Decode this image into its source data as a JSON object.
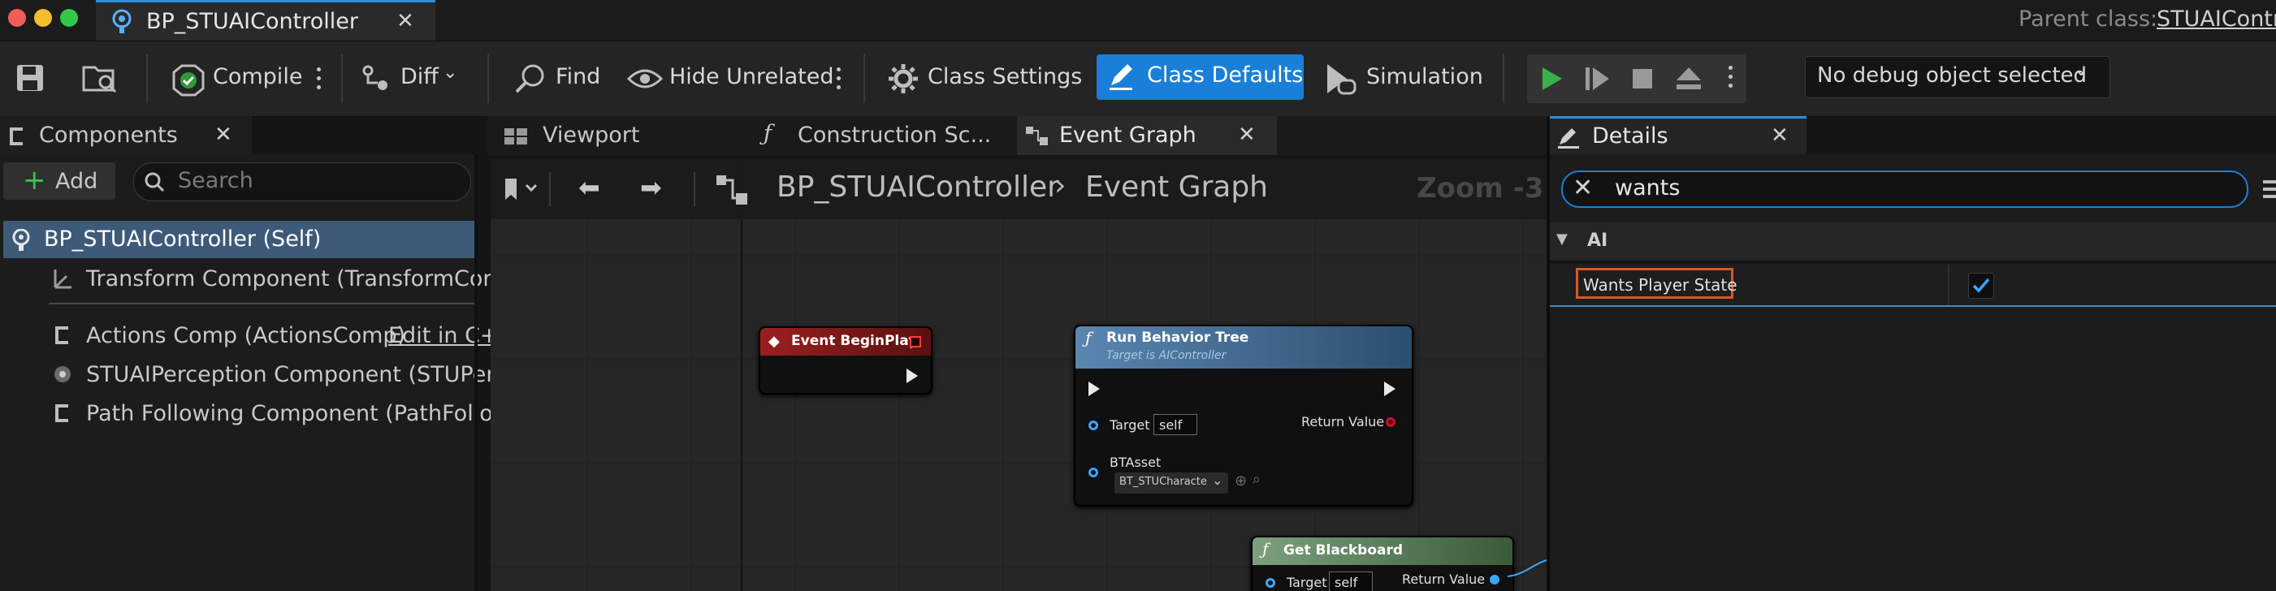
{
  "window": {
    "tab_title": "BP_STUAIController",
    "parent_class_label": "Parent class:",
    "parent_class_value": "STUAIController"
  },
  "toolbar": {
    "compile": "Compile",
    "diff": "Diff",
    "find": "Find",
    "hide_unrelated": "Hide Unrelated",
    "class_settings": "Class Settings",
    "class_defaults": "Class Defaults",
    "simulation": "Simulation",
    "debug_object": "No debug object selected"
  },
  "components_panel": {
    "title": "Components",
    "add_label": "Add",
    "search_placeholder": "Search",
    "items": [
      {
        "label": "BP_STUAIController (Self)",
        "icon": "controller-icon",
        "selected": true
      },
      {
        "label": "Transform Component (TransformComp",
        "icon": "transform-icon"
      },
      {
        "label": "Actions Comp (ActionsComp)",
        "icon": "component-icon",
        "extra": "Edit in C+"
      },
      {
        "label": "STUAIPerception Component (STUPerce",
        "icon": "perception-icon"
      },
      {
        "label": "Path Following Component (PathFollowi",
        "icon": "component-icon"
      }
    ]
  },
  "editor_tabs": {
    "viewport": "Viewport",
    "construction": "Construction Sc...",
    "event_graph": "Event Graph"
  },
  "graph": {
    "breadcrumb_root": "BP_STUAIController",
    "breadcrumb_leaf": "Event Graph",
    "zoom": "Zoom -3",
    "nodes": {
      "begin_play": {
        "title": "Event BeginPlay"
      },
      "run_bt": {
        "title": "Run Behavior Tree",
        "subtitle": "Target is AIController",
        "target_label": "Target",
        "target_value": "self",
        "return_label": "Return Value",
        "btasset_label": "BTAsset",
        "btasset_value": "BT_STUCharactе"
      },
      "get_bb": {
        "title": "Get Blackboard",
        "target_label": "Target",
        "target_value": "self",
        "return_label": "Return Value"
      }
    }
  },
  "details_panel": {
    "title": "Details",
    "search_value": "wants",
    "category": "AI",
    "property_label": "Wants Player State",
    "property_checked": true
  },
  "colors": {
    "accent_blue": "#1a7fd8",
    "event_red": "#8b1a1a",
    "function_blue": "#4d7aa0",
    "pure_green": "#4e7a4e",
    "highlight_orange": "#d8572a"
  }
}
